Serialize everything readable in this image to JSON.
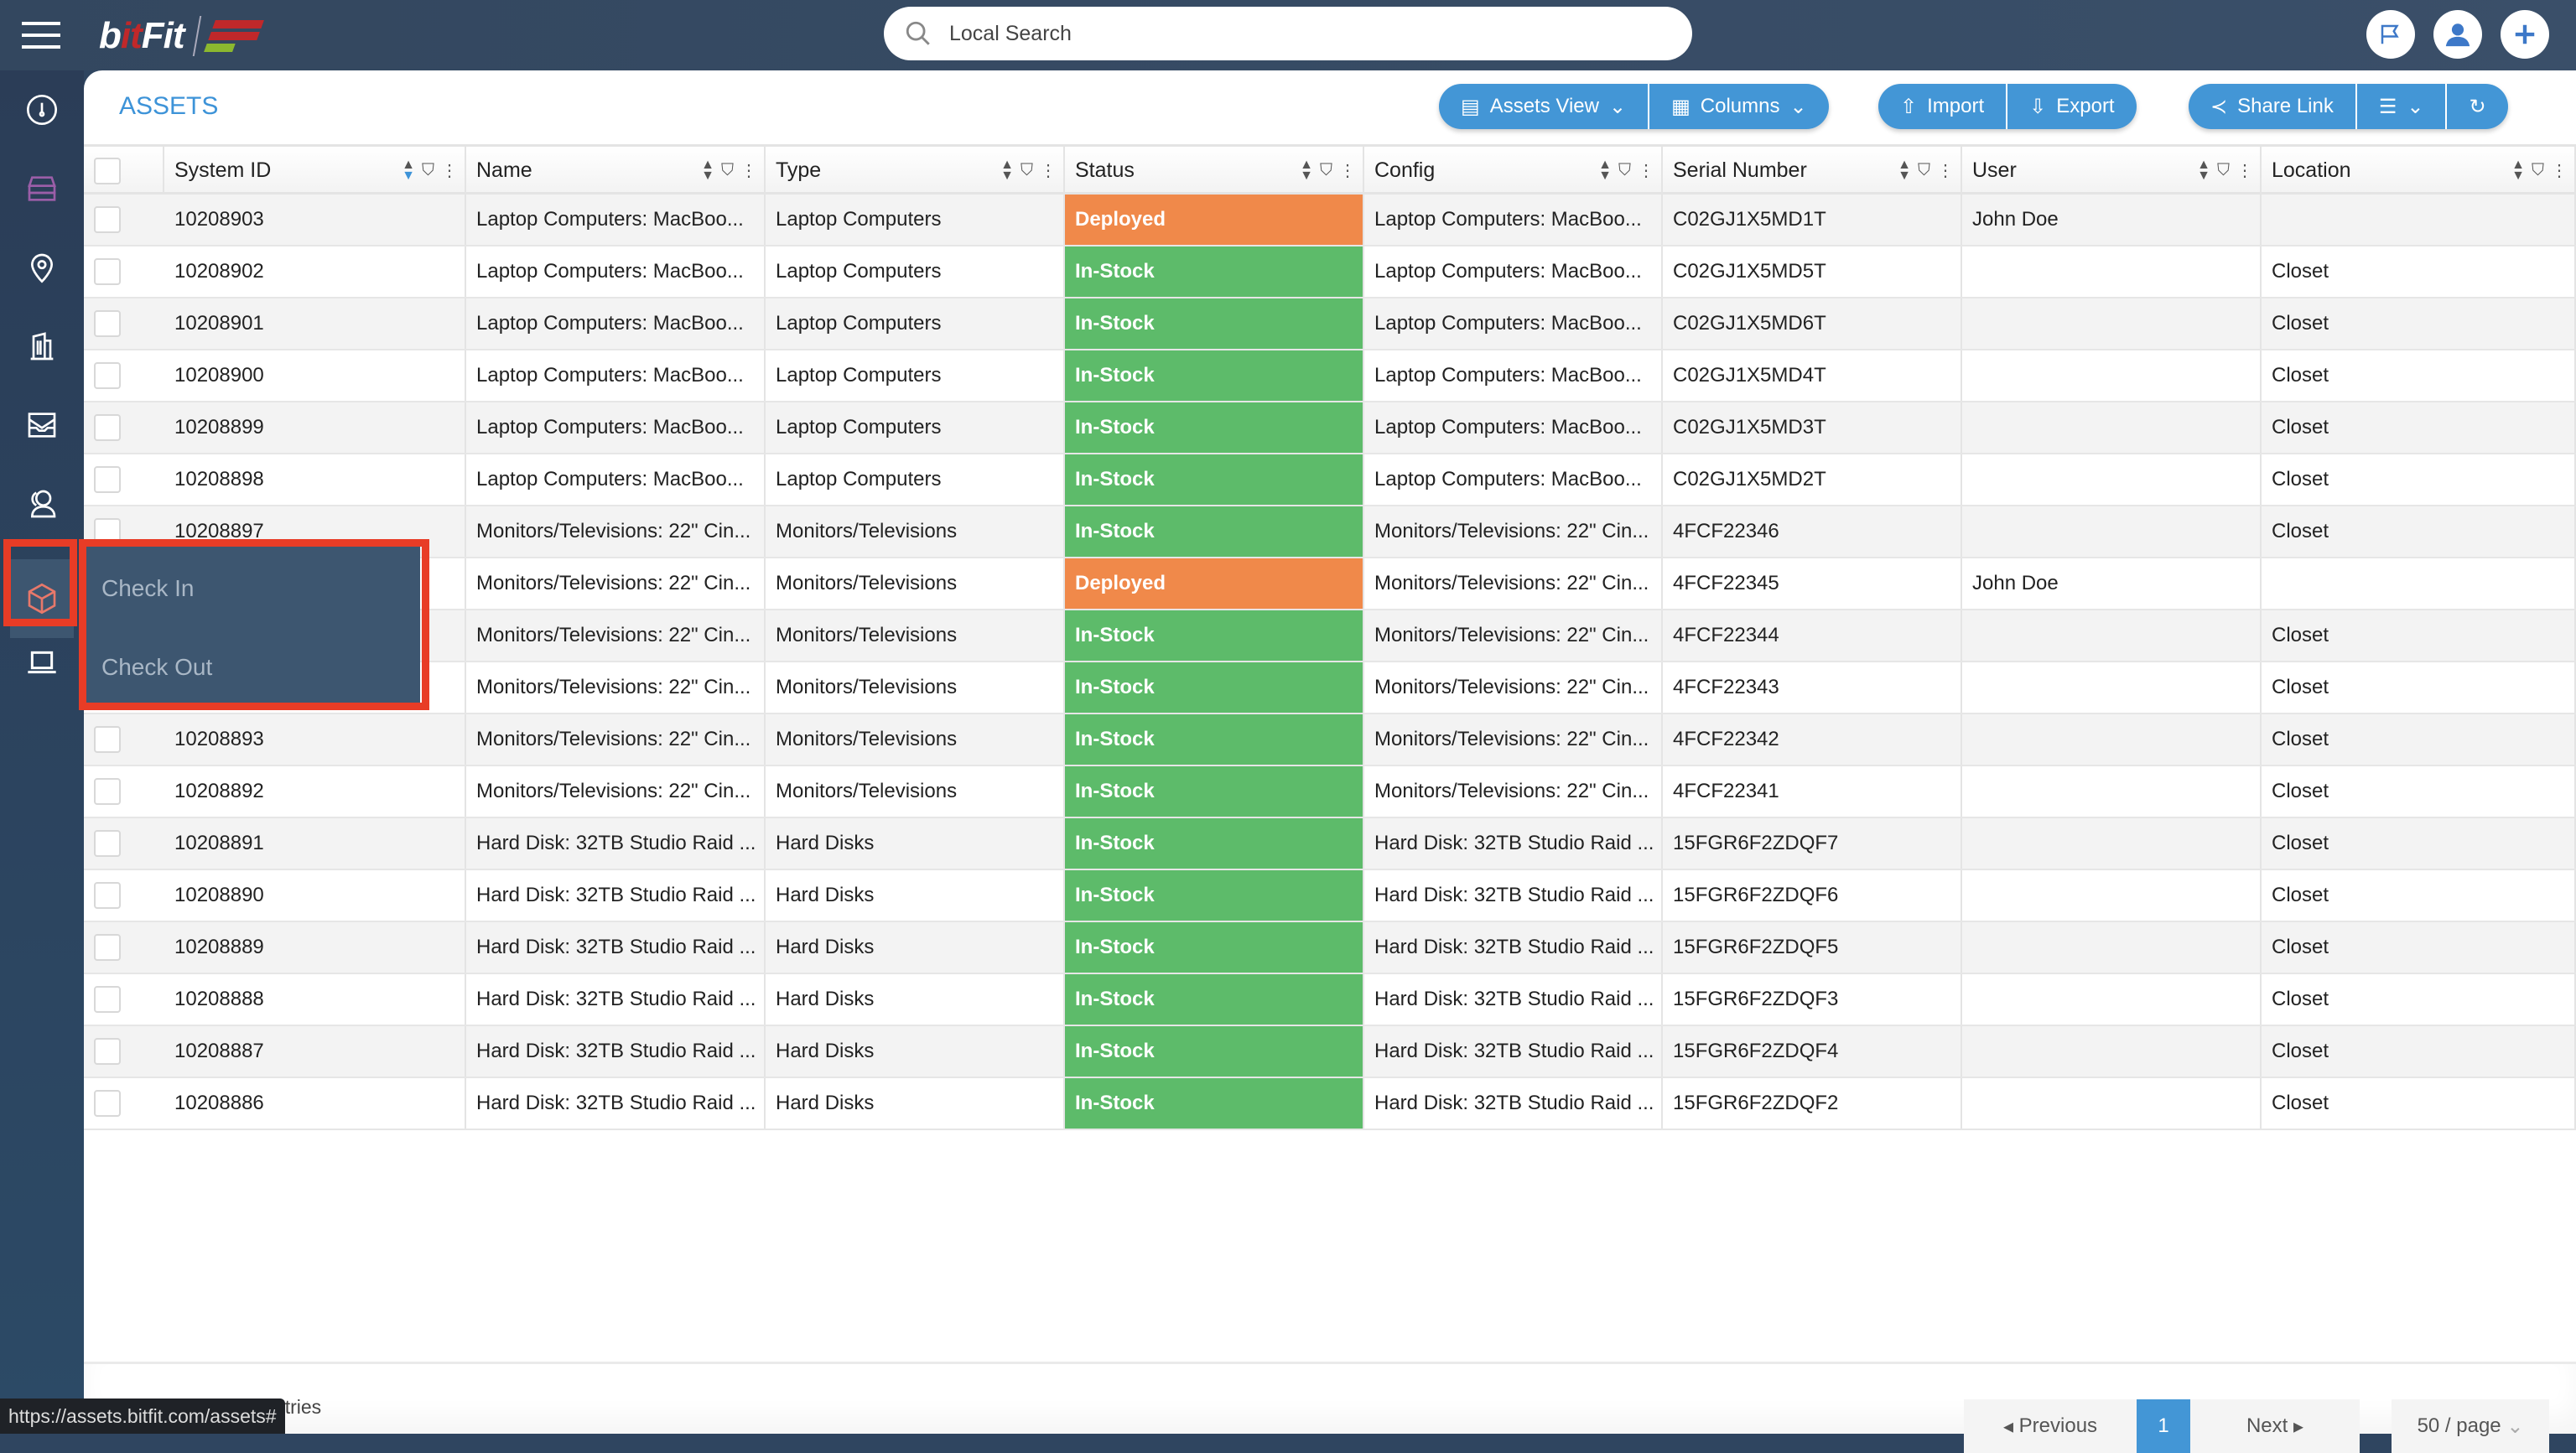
{
  "app": {
    "logo_text": "bitFit",
    "logo_mark": "EF"
  },
  "search": {
    "placeholder": "Local Search"
  },
  "top_icons": [
    "flag-icon",
    "user-icon",
    "plus-icon"
  ],
  "sidebar": {
    "items": [
      "dashboard-icon",
      "storage-icon",
      "location-icon",
      "building-icon",
      "inbox-icon",
      "users-icon",
      "box-icon",
      "laptop-icon"
    ],
    "active": "box-icon"
  },
  "popup_menu": {
    "items": [
      {
        "label": "Check In"
      },
      {
        "label": "Check Out"
      }
    ]
  },
  "page": {
    "title": "ASSETS"
  },
  "toolbar": {
    "assets_view": "Assets View",
    "columns": "Columns",
    "import": "Import",
    "export": "Export",
    "share_link": "Share Link"
  },
  "table": {
    "columns": [
      "System ID",
      "Name",
      "Type",
      "Status",
      "Config",
      "Serial Number",
      "User",
      "Location"
    ],
    "status_colors": {
      "Deployed": "#f0894a",
      "In-Stock": "#5dbb6a"
    },
    "rows": [
      [
        "10208903",
        "Laptop Computers: MacBoo...",
        "Laptop Computers",
        "Deployed",
        "Laptop Computers: MacBoo...",
        "C02GJ1X5MD1T",
        "John Doe",
        ""
      ],
      [
        "10208902",
        "Laptop Computers: MacBoo...",
        "Laptop Computers",
        "In-Stock",
        "Laptop Computers: MacBoo...",
        "C02GJ1X5MD5T",
        "",
        "Closet"
      ],
      [
        "10208901",
        "Laptop Computers: MacBoo...",
        "Laptop Computers",
        "In-Stock",
        "Laptop Computers: MacBoo...",
        "C02GJ1X5MD6T",
        "",
        "Closet"
      ],
      [
        "10208900",
        "Laptop Computers: MacBoo...",
        "Laptop Computers",
        "In-Stock",
        "Laptop Computers: MacBoo...",
        "C02GJ1X5MD4T",
        "",
        "Closet"
      ],
      [
        "10208899",
        "Laptop Computers: MacBoo...",
        "Laptop Computers",
        "In-Stock",
        "Laptop Computers: MacBoo...",
        "C02GJ1X5MD3T",
        "",
        "Closet"
      ],
      [
        "10208898",
        "Laptop Computers: MacBoo...",
        "Laptop Computers",
        "In-Stock",
        "Laptop Computers: MacBoo...",
        "C02GJ1X5MD2T",
        "",
        "Closet"
      ],
      [
        "10208897",
        "Monitors/Televisions: 22\" Cin...",
        "Monitors/Televisions",
        "In-Stock",
        "Monitors/Televisions: 22\" Cin...",
        "4FCF22346",
        "",
        "Closet"
      ],
      [
        "",
        "Monitors/Televisions: 22\" Cin...",
        "Monitors/Televisions",
        "Deployed",
        "Monitors/Televisions: 22\" Cin...",
        "4FCF22345",
        "John Doe",
        ""
      ],
      [
        "",
        "Monitors/Televisions: 22\" Cin...",
        "Monitors/Televisions",
        "In-Stock",
        "Monitors/Televisions: 22\" Cin...",
        "4FCF22344",
        "",
        "Closet"
      ],
      [
        "",
        "Monitors/Televisions: 22\" Cin...",
        "Monitors/Televisions",
        "In-Stock",
        "Monitors/Televisions: 22\" Cin...",
        "4FCF22343",
        "",
        "Closet"
      ],
      [
        "10208893",
        "Monitors/Televisions: 22\" Cin...",
        "Monitors/Televisions",
        "In-Stock",
        "Monitors/Televisions: 22\" Cin...",
        "4FCF22342",
        "",
        "Closet"
      ],
      [
        "10208892",
        "Monitors/Televisions: 22\" Cin...",
        "Monitors/Televisions",
        "In-Stock",
        "Monitors/Televisions: 22\" Cin...",
        "4FCF22341",
        "",
        "Closet"
      ],
      [
        "10208891",
        "Hard Disk: 32TB Studio Raid ...",
        "Hard Disks",
        "In-Stock",
        "Hard Disk: 32TB Studio Raid ...",
        "15FGR6F2ZDQF7",
        "",
        "Closet"
      ],
      [
        "10208890",
        "Hard Disk: 32TB Studio Raid ...",
        "Hard Disks",
        "In-Stock",
        "Hard Disk: 32TB Studio Raid ...",
        "15FGR6F2ZDQF6",
        "",
        "Closet"
      ],
      [
        "10208889",
        "Hard Disk: 32TB Studio Raid ...",
        "Hard Disks",
        "In-Stock",
        "Hard Disk: 32TB Studio Raid ...",
        "15FGR6F2ZDQF5",
        "",
        "Closet"
      ],
      [
        "10208888",
        "Hard Disk: 32TB Studio Raid ...",
        "Hard Disks",
        "In-Stock",
        "Hard Disk: 32TB Studio Raid ...",
        "15FGR6F2ZDQF3",
        "",
        "Closet"
      ],
      [
        "10208887",
        "Hard Disk: 32TB Studio Raid ...",
        "Hard Disks",
        "In-Stock",
        "Hard Disk: 32TB Studio Raid ...",
        "15FGR6F2ZDQF4",
        "",
        "Closet"
      ],
      [
        "10208886",
        "Hard Disk: 32TB Studio Raid ...",
        "Hard Disks",
        "In-Stock",
        "Hard Disk: 32TB Studio Raid ...",
        "15FGR6F2ZDQF2",
        "",
        "Closet"
      ]
    ]
  },
  "footer": {
    "showing": "Showing 18 of 18 entries",
    "previous": "Previous",
    "current_page": "1",
    "next": "Next",
    "page_size": "50 / page"
  },
  "status_bar": {
    "url": "https://assets.bitfit.com/assets#"
  },
  "colors": {
    "accent": "#4396d6",
    "highlight": "#e83c26",
    "sidebar": "#2b3d57"
  }
}
